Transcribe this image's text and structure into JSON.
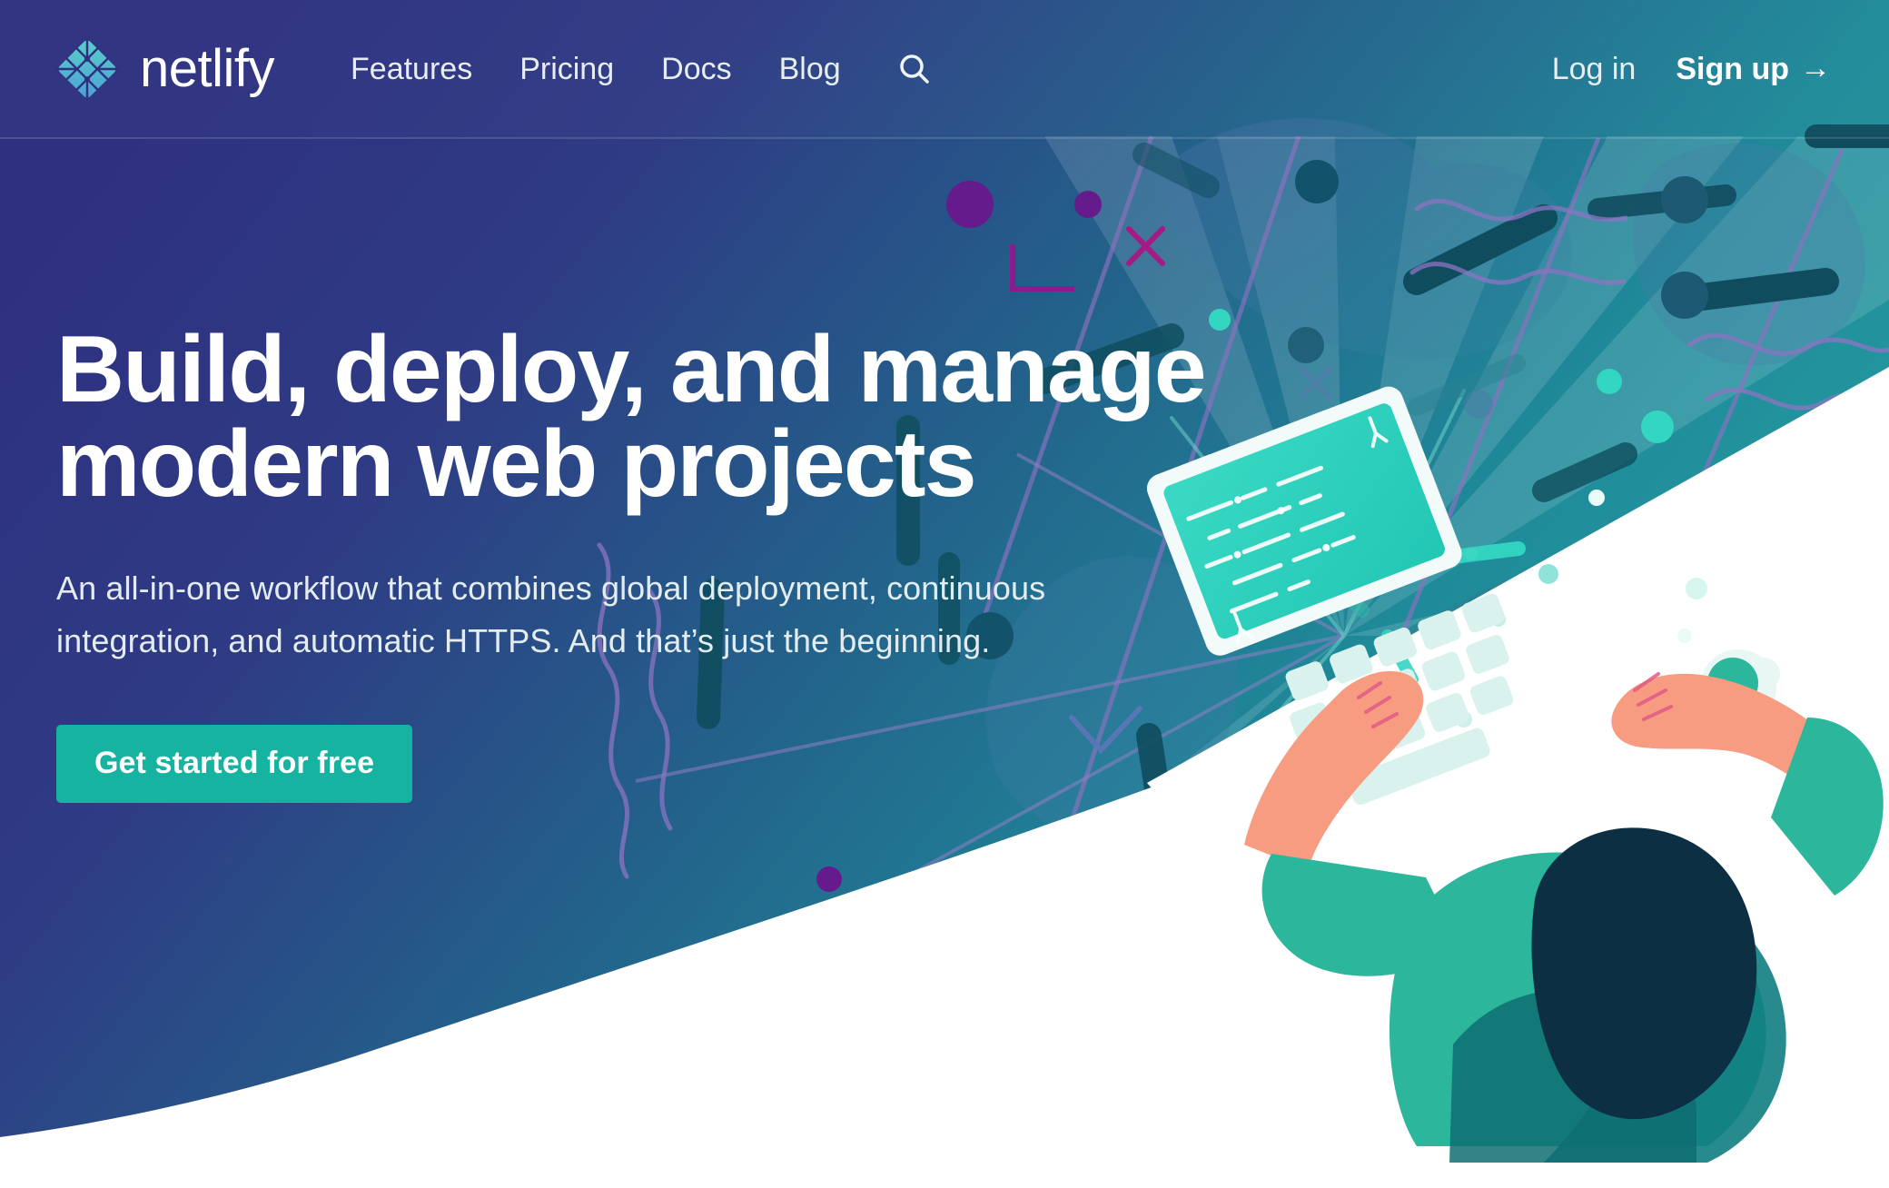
{
  "brand": {
    "name": "netlify",
    "logo_icon": "netlify-diamond-logo"
  },
  "nav": {
    "links": [
      {
        "label": "Features"
      },
      {
        "label": "Pricing"
      },
      {
        "label": "Docs"
      },
      {
        "label": "Blog"
      }
    ],
    "search_icon": "search-icon",
    "login_label": "Log in",
    "signup_label": "Sign up",
    "signup_arrow": "→"
  },
  "hero": {
    "title_line1": "Build, deploy, and manage",
    "title_line2": "modern web projects",
    "subtitle": "An all-in-one workflow that combines global deployment, continuous integration, and automatic HTTPS. And that’s just the beginning.",
    "cta_label": "Get started for free"
  },
  "colors": {
    "gradient_left": "#2e3180",
    "gradient_mid": "#1f6b8e",
    "gradient_right": "#26a2a4",
    "cta_background": "#16b4a0",
    "cta_text": "#ffffff",
    "accent_purple": "#651b8c",
    "accent_magenta": "#a61a86",
    "dark_teal": "#0f4d5e",
    "bright_teal": "#33d6c0",
    "skin": "#f79c80",
    "hair_navy": "#0d2f44",
    "shirt_teal": "#2cb69b",
    "page_background": "#ffffff",
    "nav_divider": "rgba(255,255,255,0.14)"
  },
  "illustration": {
    "name": "person-typing-on-laptop-top-view",
    "elements": [
      "laptop",
      "keyboard",
      "coffee-cup",
      "hands",
      "desk"
    ]
  }
}
